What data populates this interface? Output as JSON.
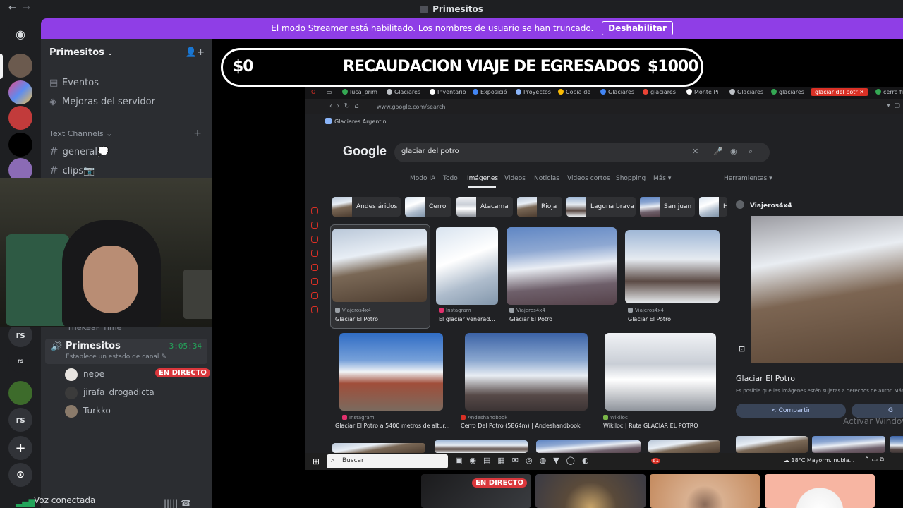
{
  "window": {
    "title": "Primesitos",
    "back": "←",
    "forward": "→"
  },
  "banner": {
    "text": "El modo Streamer está habilitado. Los nombres de usuario se han truncado.",
    "button": "Deshabilitar"
  },
  "rail": {
    "items": [
      "rs",
      "rs",
      "rs"
    ]
  },
  "server": {
    "name": "Primesitos",
    "items": [
      {
        "label": "Eventos",
        "icon": "calendar-icon"
      },
      {
        "label": "Mejoras del servidor",
        "icon": "boost-icon"
      }
    ],
    "category": "Text Channels",
    "channels": [
      {
        "label": "general",
        "emoji": "💭"
      },
      {
        "label": "clips",
        "emoji": "📷"
      }
    ]
  },
  "voice": {
    "previous_channel": "TheKeaF Time",
    "channel": "Primesitos",
    "time": "3:05:34",
    "status_placeholder": "Establece un estado de canal",
    "users": [
      {
        "name": "nepe",
        "live": "EN DIRECTO"
      },
      {
        "name": "jirafa_drogadicta"
      },
      {
        "name": "Turkko"
      }
    ],
    "connected": "Voz conectada"
  },
  "fund": {
    "left": "$0",
    "center": "RECAUDACION VIAJE DE EGRESADOS",
    "right": "$1000"
  },
  "browser": {
    "tabs": [
      "luca_prim",
      "Glaciares",
      "Inventario",
      "Exposició",
      "Proyectos",
      "Copia de",
      "Glaciares",
      "glaciares",
      "Monte Pi",
      "Glaciares",
      "glaciares",
      "glaciar del potr",
      "cerro fi"
    ],
    "url": "www.google.com/search",
    "bookmark": "Glaciares Argentin...",
    "query": "glaciar del potro",
    "search_tabs": [
      "Modo IA",
      "Todo",
      "Imágenes",
      "Videos",
      "Noticias",
      "Videos cortos",
      "Shopping",
      "Más ▾"
    ],
    "tools": "Herramientas ▾",
    "chips": [
      "Andes áridos",
      "Cerro",
      "Atacama",
      "Rioja",
      "Laguna brava",
      "San juan",
      "H"
    ],
    "results_row1": [
      {
        "source": "Viajeros4x4",
        "title": "Glaciar El Potro"
      },
      {
        "source": "Instagram",
        "title": "El glaciar venerad..."
      },
      {
        "source": "Viajeros4x4",
        "title": "Glaciar El Potro"
      },
      {
        "source": "Viajeros4x4",
        "title": "Glaciar El Potro"
      }
    ],
    "results_row2": [
      {
        "source": "Instagram",
        "title": "Glaciar El Potro a 5400 metros de altur..."
      },
      {
        "source": "Andeshandbook",
        "title": "Cerro Del Potro (5864m) | Andeshandbook"
      },
      {
        "source": "Wikiloc",
        "title": "Wikiloc | Ruta GLACIAR EL POTRO"
      }
    ],
    "panel": {
      "source": "Viajeros4x4",
      "title": "Glaciar El Potro",
      "note": "Es posible que las imágenes estén sujetas a derechos de autor. Más inf",
      "share": "Compartir",
      "save": "G",
      "activate": "Activar Window"
    }
  },
  "taskbar": {
    "search": "Buscar",
    "weather": "18°C  Mayorm. nubla...",
    "badge": "61"
  },
  "tiles": {
    "live": "EN DIRECTO"
  }
}
